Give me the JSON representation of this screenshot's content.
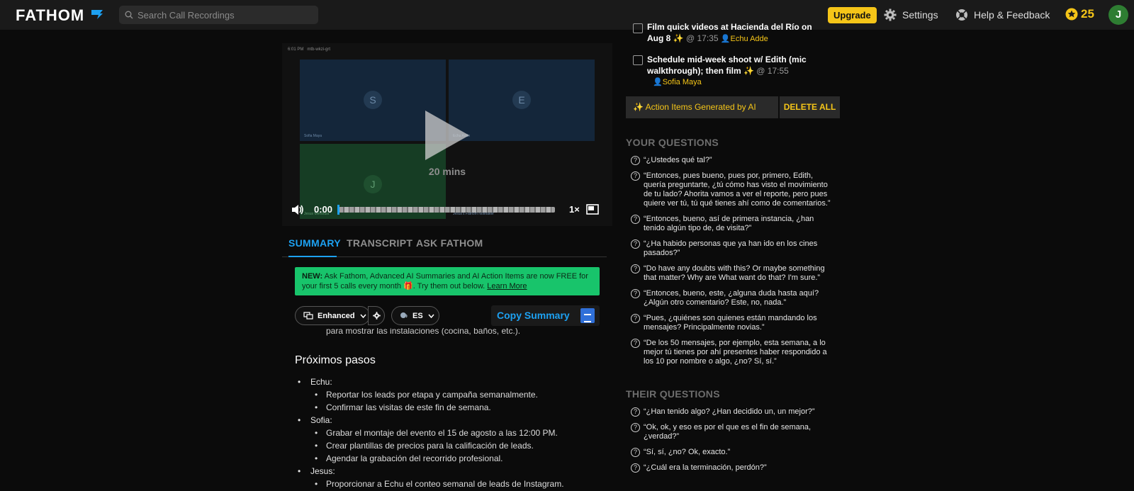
{
  "topbar": {
    "logo": "FATHOM",
    "search_placeholder": "Search Call Recordings",
    "upgrade": "Upgrade",
    "settings": "Settings",
    "help": "Help & Feedback",
    "credits": "25",
    "avatar_initial": "J"
  },
  "video": {
    "meta_time": "6:01 PM",
    "meta_id": "mtb-wkzi-grt",
    "tiles": [
      {
        "initial": "S",
        "name": "Sofia Maya"
      },
      {
        "initial": "E",
        "name": "Echu Adde"
      },
      {
        "initial": "J",
        "name": "Jesus Mendoza"
      },
      {
        "initial": "",
        "name": "Jesus's Fathom Notetaker"
      }
    ],
    "duration": "20 mins",
    "current_time": "0:00",
    "progress": 0,
    "speed": "1×"
  },
  "tabs": [
    "SUMMARY",
    "TRANSCRIPT",
    "ASK FATHOM"
  ],
  "active_tab": "SUMMARY",
  "banner": {
    "prefix": "NEW:",
    "text": " Ask Fathom, Advanced AI Summaries and AI Action Items are now FREE for your first 5 calls every month 🎁. Try them out below. ",
    "link": "Learn More"
  },
  "summary_controls": {
    "mode": "Enhanced",
    "language": "ES",
    "copy": "Copy Summary"
  },
  "summary": {
    "cut_line": "para mostrar las instalaciones (cocina, baños, etc.).",
    "heading": "Próximos pasos",
    "people": [
      {
        "name": "Echu:",
        "items": [
          "Reportar los leads por etapa y campaña semanalmente.",
          "Confirmar las visitas de este fin de semana."
        ]
      },
      {
        "name": "Sofia:",
        "items": [
          "Grabar el montaje del evento el 15 de agosto a las 12:00 PM.",
          "Crear plantillas de precios para la calificación de leads.",
          "Agendar la grabación del recorrido profesional."
        ]
      },
      {
        "name": "Jesus:",
        "items": [
          "Proporcionar a Echu el conteo semanal de leads de Instagram."
        ]
      }
    ]
  },
  "action_items": [
    {
      "text_a": "Film quick videos at Hacienda del Río on",
      "text_b": "Aug 8 ✨",
      "time": "@ 17:35",
      "assignee": "Echu Adde"
    },
    {
      "text_a": "Schedule mid-week shoot w/ Edith (mic",
      "text_b": "walkthrough); then film ✨",
      "time": "@ 17:55",
      "assignee": "Sofia Maya"
    }
  ],
  "ai_bar_label": "✨ Action Items Generated by AI",
  "delete_all": "DELETE ALL",
  "your_questions_title": "YOUR QUESTIONS",
  "your_questions": [
    "“¿Ustedes qué tal?”",
    "“Entonces, pues bueno, pues por, primero, Edith, quería preguntarte, ¿tú cómo has visto el movimiento de tu lado? Ahorita vamos a ver el reporte, pero pues quiere ver tú, tú qué tienes ahí como de comentarios.”",
    "“Entonces, bueno, así de primera instancia, ¿han tenido algún tipo de, de visita?”",
    "“¿Ha habido personas que ya han ido en los cines pasados?”",
    "“Do have any doubts with this? Or maybe something that matter? Why are What want do that? I'm sure.”",
    "“Entonces, bueno, este, ¿alguna duda hasta aquí? ¿Algún otro comentario? Este, no, nada.”",
    "“Pues, ¿quiénes son quienes están mandando los mensajes? Principalmente novias.”",
    "“De los 50 mensajes, por ejemplo, esta semana, a lo mejor tú tienes por ahí presentes haber respondido a los 10 por nombre o algo, ¿no? Sí, sí.”"
  ],
  "their_questions_title": "THEIR QUESTIONS",
  "their_questions": [
    "“¿Han tenido algo? ¿Han decidido un, un mejor?”",
    "“Ok, ok, y eso es por el que es el fin de semana, ¿verdad?”",
    "“Sí, sí, ¿no? Ok, exacto.”",
    "“¿Cuál era la terminación, perdón?”"
  ]
}
